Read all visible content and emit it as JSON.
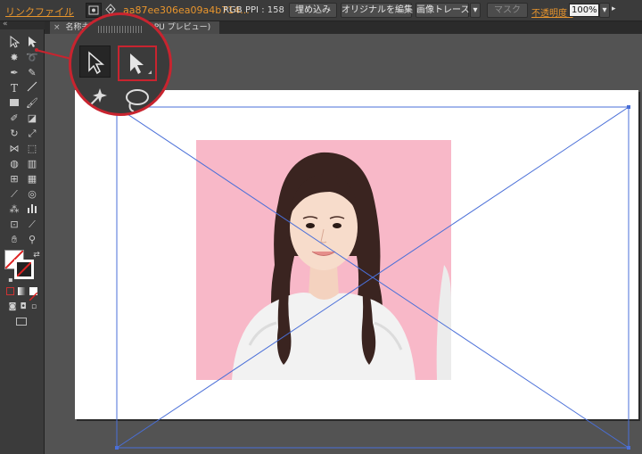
{
  "control_bar": {
    "link_file_label": "リンクファイル",
    "file_name": "aa87ee306ea09a4b714...",
    "color_mode": "RGB",
    "ppi_label": "PPI : 158",
    "embed_button": "埋め込み",
    "edit_original_button": "オリジナルを編集",
    "image_trace_button": "画像トレース",
    "mask_button": "マスク",
    "opacity_label": "不透明度 :",
    "opacity_value": "100%"
  },
  "document_tab": {
    "name_visible": "名称未",
    "name_suffix": "B/GPU プレビュー)"
  },
  "tools": [
    "selection-tool",
    "direct-selection-tool",
    "magic-wand-tool",
    "lasso-tool",
    "pen-tool",
    "curvature-tool",
    "type-tool",
    "line-tool",
    "rectangle-tool",
    "paintbrush-tool",
    "shaper-tool",
    "eraser-tool",
    "rotate-tool",
    "scale-tool",
    "width-tool",
    "free-transform-tool",
    "shape-builder-tool",
    "perspective-grid-tool",
    "mesh-tool",
    "gradient-tool",
    "eyedropper-tool",
    "blend-tool",
    "symbol-sprayer-tool",
    "column-graph-tool",
    "artboard-tool",
    "slice-tool",
    "hand-tool",
    "zoom-tool"
  ],
  "colors": {
    "accent_red": "#c8242f",
    "link_orange": "#e8952d",
    "frame_blue": "#4a6fd8",
    "photo_bg_pink": "#f8b8c8"
  }
}
